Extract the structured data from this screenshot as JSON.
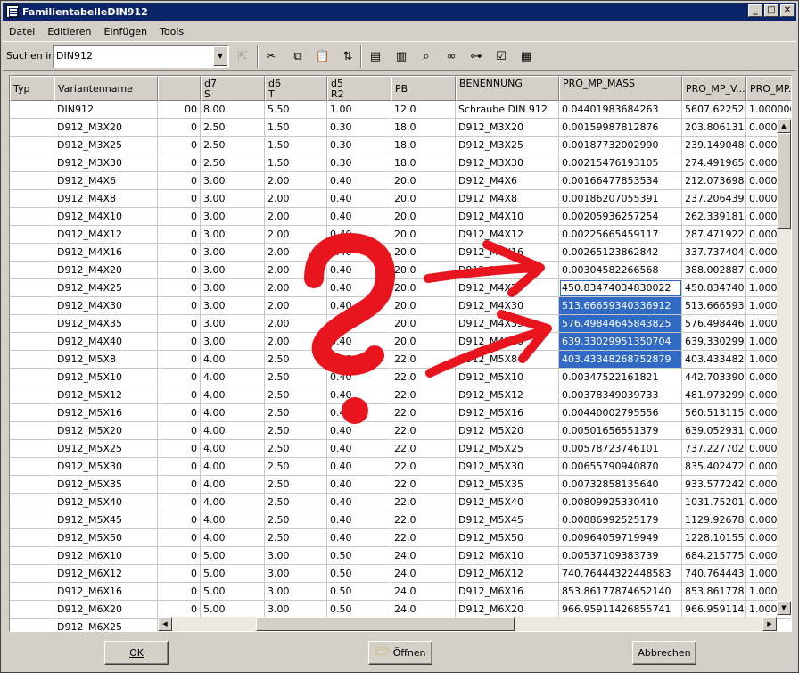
{
  "window": {
    "title": "FamilientabelleDIN912",
    "controls": [
      "_",
      "□",
      "✕"
    ]
  },
  "menu": [
    {
      "label": "Datei"
    },
    {
      "label": "Editieren"
    },
    {
      "label": "Einfügen"
    },
    {
      "label": "Tools"
    }
  ],
  "toolbar": {
    "search_label": "Suchen in:",
    "search_value": "DIN912",
    "icons": [
      "go-up-icon",
      "cut-icon",
      "copy-icon",
      "paste-icon",
      "insert-column-icon",
      "find-row-icon",
      "insert-instance-icon",
      "find-icon",
      "glasses-preview-icon",
      "tree-icon",
      "check-table-icon",
      "table-icon"
    ]
  },
  "table": {
    "columns": [
      {
        "key": "typ",
        "label": "Typ",
        "sub": ""
      },
      {
        "key": "name",
        "label": "Variantenname",
        "sub": ""
      },
      {
        "key": "x",
        "label": "",
        "sub": ""
      },
      {
        "key": "d7",
        "label": "d7",
        "sub": "S"
      },
      {
        "key": "d6",
        "label": "d6",
        "sub": "T"
      },
      {
        "key": "d5",
        "label": "d5",
        "sub": "R2"
      },
      {
        "key": "pb",
        "label": "PB",
        "sub": ""
      },
      {
        "key": "ben",
        "label": "BENENNUNG",
        "sub": ""
      },
      {
        "key": "mass",
        "label": "PRO_MP_MASS",
        "sub": ""
      },
      {
        "key": "vol",
        "label": "PRO_MP_V...",
        "sub": ""
      },
      {
        "key": "pm",
        "label": "PRO_MP...",
        "sub": ""
      }
    ],
    "rows": [
      {
        "name": "DIN912",
        "x": "00",
        "d7": "8.00",
        "d6": "5.50",
        "d5": "1.00",
        "pb": "12.0",
        "ben": "Schraube DIN 912",
        "mass": "0.04401983684263",
        "vol": "5607.62252...",
        "pm": "1.0000000"
      },
      {
        "name": "D912_M3X20",
        "x": "0",
        "d7": "2.50",
        "d6": "1.50",
        "d5": "0.30",
        "pb": "18.0",
        "ben": "D912_M3X20",
        "mass": "0.00159987812876",
        "vol": "203.806131...",
        "pm": "0.0000"
      },
      {
        "name": "D912_M3X25",
        "x": "0",
        "d7": "2.50",
        "d6": "1.50",
        "d5": "0.30",
        "pb": "18.0",
        "ben": "D912_M3X25",
        "mass": "0.00187732002990",
        "vol": "239.149048...",
        "pm": "0.0000"
      },
      {
        "name": "D912_M3X30",
        "x": "0",
        "d7": "2.50",
        "d6": "1.50",
        "d5": "0.30",
        "pb": "18.0",
        "ben": "D912_M3X30",
        "mass": "0.00215476193105",
        "vol": "274.491965...",
        "pm": "0.0000"
      },
      {
        "name": "D912_M4X6",
        "x": "0",
        "d7": "3.00",
        "d6": "2.00",
        "d5": "0.40",
        "pb": "20.0",
        "ben": "D912_M4X6",
        "mass": "0.00166477853534",
        "vol": "212.073698...",
        "pm": "0.0000"
      },
      {
        "name": "D912_M4X8",
        "x": "0",
        "d7": "3.00",
        "d6": "2.00",
        "d5": "0.40",
        "pb": "20.0",
        "ben": "D912_M4X8",
        "mass": "0.00186207055391",
        "vol": "237.206439...",
        "pm": "0.0000"
      },
      {
        "name": "D912_M4X10",
        "x": "0",
        "d7": "3.00",
        "d6": "2.00",
        "d5": "0.40",
        "pb": "20.0",
        "ben": "D912_M4X10",
        "mass": "0.00205936257254",
        "vol": "262.339181...",
        "pm": "0.0000"
      },
      {
        "name": "D912_M4X12",
        "x": "0",
        "d7": "3.00",
        "d6": "2.00",
        "d5": "0.40",
        "pb": "20.0",
        "ben": "D912_M4X12",
        "mass": "0.00225665459117",
        "vol": "287.471922...",
        "pm": "0.0000"
      },
      {
        "name": "D912_M4X16",
        "x": "0",
        "d7": "3.00",
        "d6": "2.00",
        "d5": "0.40",
        "pb": "20.0",
        "ben": "D912_M4X16",
        "mass": "0.00265123862842",
        "vol": "337.737404...",
        "pm": "0.0000"
      },
      {
        "name": "D912_M4X20",
        "x": "0",
        "d7": "3.00",
        "d6": "2.00",
        "d5": "0.40",
        "pb": "20.0",
        "ben": "D912_M4X20",
        "mass": "0.00304582266568",
        "vol": "388.002887...",
        "pm": "0.0000"
      },
      {
        "name": "D912_M4X25",
        "x": "0",
        "d7": "3.00",
        "d6": "2.00",
        "d5": "0.40",
        "pb": "20.0",
        "ben": "D912_M4X25",
        "mass": "450.83474034830022",
        "vol": "450.834740...",
        "pm": "1.0000",
        "state": "edit"
      },
      {
        "name": "D912_M4X30",
        "x": "0",
        "d7": "3.00",
        "d6": "2.00",
        "d5": "0.40",
        "pb": "20.0",
        "ben": "D912_M4X30",
        "mass": "513.66659340336912",
        "vol": "513.666593...",
        "pm": "1.0000",
        "state": "sel"
      },
      {
        "name": "D912_M4X35",
        "x": "0",
        "d7": "3.00",
        "d6": "2.00",
        "d5": "0.40",
        "pb": "20.0",
        "ben": "D912_M4X35",
        "mass": "576.49844645843825",
        "vol": "576.498446...",
        "pm": "1.0000",
        "state": "sel"
      },
      {
        "name": "D912_M4X40",
        "x": "0",
        "d7": "3.00",
        "d6": "2.00",
        "d5": "0.40",
        "pb": "20.0",
        "ben": "D912_M4X40",
        "mass": "639.33029951350704",
        "vol": "639.330299...",
        "pm": "1.0000",
        "state": "sel"
      },
      {
        "name": "D912_M5X8",
        "x": "0",
        "d7": "4.00",
        "d6": "2.50",
        "d5": "0.40",
        "pb": "22.0",
        "ben": "D912_M5X8",
        "mass": "403.43348268752879",
        "vol": "403.433482...",
        "pm": "1.0000",
        "state": "sel"
      },
      {
        "name": "D912_M5X10",
        "x": "0",
        "d7": "4.00",
        "d6": "2.50",
        "d5": "0.40",
        "pb": "22.0",
        "ben": "D912_M5X10",
        "mass": "0.00347522161821",
        "vol": "442.703390...",
        "pm": "0.0000"
      },
      {
        "name": "D912_M5X12",
        "x": "0",
        "d7": "4.00",
        "d6": "2.50",
        "d5": "0.40",
        "pb": "22.0",
        "ben": "D912_M5X12",
        "mass": "0.00378349039733",
        "vol": "481.973299...",
        "pm": "0.0000"
      },
      {
        "name": "D912_M5X16",
        "x": "0",
        "d7": "4.00",
        "d6": "2.50",
        "d5": "0.40",
        "pb": "22.0",
        "ben": "D912_M5X16",
        "mass": "0.00440002795556",
        "vol": "560.513115...",
        "pm": "0.0000"
      },
      {
        "name": "D912_M5X20",
        "x": "0",
        "d7": "4.00",
        "d6": "2.50",
        "d5": "0.40",
        "pb": "22.0",
        "ben": "D912_M5X20",
        "mass": "0.00501656551379",
        "vol": "639.052931...",
        "pm": "0.0000"
      },
      {
        "name": "D912_M5X25",
        "x": "0",
        "d7": "4.00",
        "d6": "2.50",
        "d5": "0.40",
        "pb": "22.0",
        "ben": "D912_M5X25",
        "mass": "0.00578723746101",
        "vol": "737.227702...",
        "pm": "0.0000"
      },
      {
        "name": "D912_M5X30",
        "x": "0",
        "d7": "4.00",
        "d6": "2.50",
        "d5": "0.40",
        "pb": "22.0",
        "ben": "D912_M5X30",
        "mass": "0.00655790940870",
        "vol": "835.402472...",
        "pm": "0.0000"
      },
      {
        "name": "D912_M5X35",
        "x": "0",
        "d7": "4.00",
        "d6": "2.50",
        "d5": "0.40",
        "pb": "22.0",
        "ben": "D912_M5X35",
        "mass": "0.00732858135640",
        "vol": "933.577242...",
        "pm": "0.0000"
      },
      {
        "name": "D912_M5X40",
        "x": "0",
        "d7": "4.00",
        "d6": "2.50",
        "d5": "0.40",
        "pb": "22.0",
        "ben": "D912_M5X40",
        "mass": "0.00809925330410",
        "vol": "1031.75201...",
        "pm": "0.0000"
      },
      {
        "name": "D912_M5X45",
        "x": "0",
        "d7": "4.00",
        "d6": "2.50",
        "d5": "0.40",
        "pb": "22.0",
        "ben": "D912_M5X45",
        "mass": "0.00886992525179",
        "vol": "1129.92678...",
        "pm": "0.0000"
      },
      {
        "name": "D912_M5X50",
        "x": "0",
        "d7": "4.00",
        "d6": "2.50",
        "d5": "0.40",
        "pb": "22.0",
        "ben": "D912_M5X50",
        "mass": "0.00964059719949",
        "vol": "1228.10155...",
        "pm": "0.0000"
      },
      {
        "name": "D912_M6X10",
        "x": "0",
        "d7": "5.00",
        "d6": "3.00",
        "d5": "0.50",
        "pb": "24.0",
        "ben": "D912_M6X10",
        "mass": "0.00537109383739",
        "vol": "684.215775...",
        "pm": "0.0000"
      },
      {
        "name": "D912_M6X12",
        "x": "0",
        "d7": "5.00",
        "d6": "3.00",
        "d5": "0.50",
        "pb": "24.0",
        "ben": "D912_M6X12",
        "mass": "740.76444322448583",
        "vol": "740.764443...",
        "pm": "1.0000"
      },
      {
        "name": "D912_M6X16",
        "x": "0",
        "d7": "5.00",
        "d6": "3.00",
        "d5": "0.50",
        "pb": "24.0",
        "ben": "D912_M6X16",
        "mass": "853.86177874652140",
        "vol": "853.861778...",
        "pm": "1.0000"
      },
      {
        "name": "D912_M6X20",
        "x": "0",
        "d7": "5.00",
        "d6": "3.00",
        "d5": "0.50",
        "pb": "24.0",
        "ben": "D912_M6X20",
        "mass": "966.95911426855741",
        "vol": "966.959114...",
        "pm": "1.0000"
      },
      {
        "name": "D912_M6X25",
        "x": "",
        "d7": "",
        "d6": "",
        "d5": "",
        "pb": "",
        "ben": "",
        "mass": "",
        "vol": "",
        "pm": ""
      }
    ]
  },
  "buttons": {
    "ok": "OK",
    "open": "Öffnen",
    "cancel": "Abbrechen"
  },
  "annotation": {
    "question_mark_color": "#e8141e",
    "arrows": 2
  },
  "colors": {
    "selection": "#316ac5",
    "title_bar": "#0a246a",
    "face": "#d4d0c8"
  }
}
